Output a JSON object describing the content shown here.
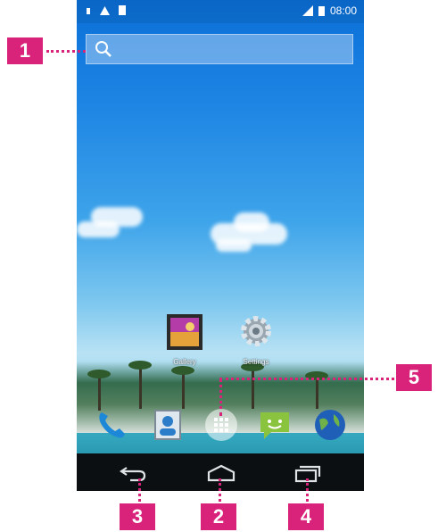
{
  "status_bar": {
    "time": "08:00",
    "left_icons": [
      "usb-icon",
      "warning-icon",
      "sd-card-icon"
    ],
    "right_icons": [
      "signal-icon",
      "battery-icon"
    ]
  },
  "search": {
    "icon": "search-icon"
  },
  "home_apps": [
    {
      "label": "Gallery",
      "icon": "gallery-icon"
    },
    {
      "label": "Settings",
      "icon": "settings-gear-icon"
    }
  ],
  "dock": [
    "phone-icon",
    "contacts-icon",
    "app-drawer-icon",
    "messaging-icon",
    "browser-globe-icon"
  ],
  "nav": [
    "back-icon",
    "home-icon",
    "recent-apps-icon"
  ],
  "callouts": [
    "1",
    "2",
    "3",
    "4",
    "5"
  ],
  "colors": {
    "callout": "#d9237b",
    "navbar": "#0b0f12"
  }
}
